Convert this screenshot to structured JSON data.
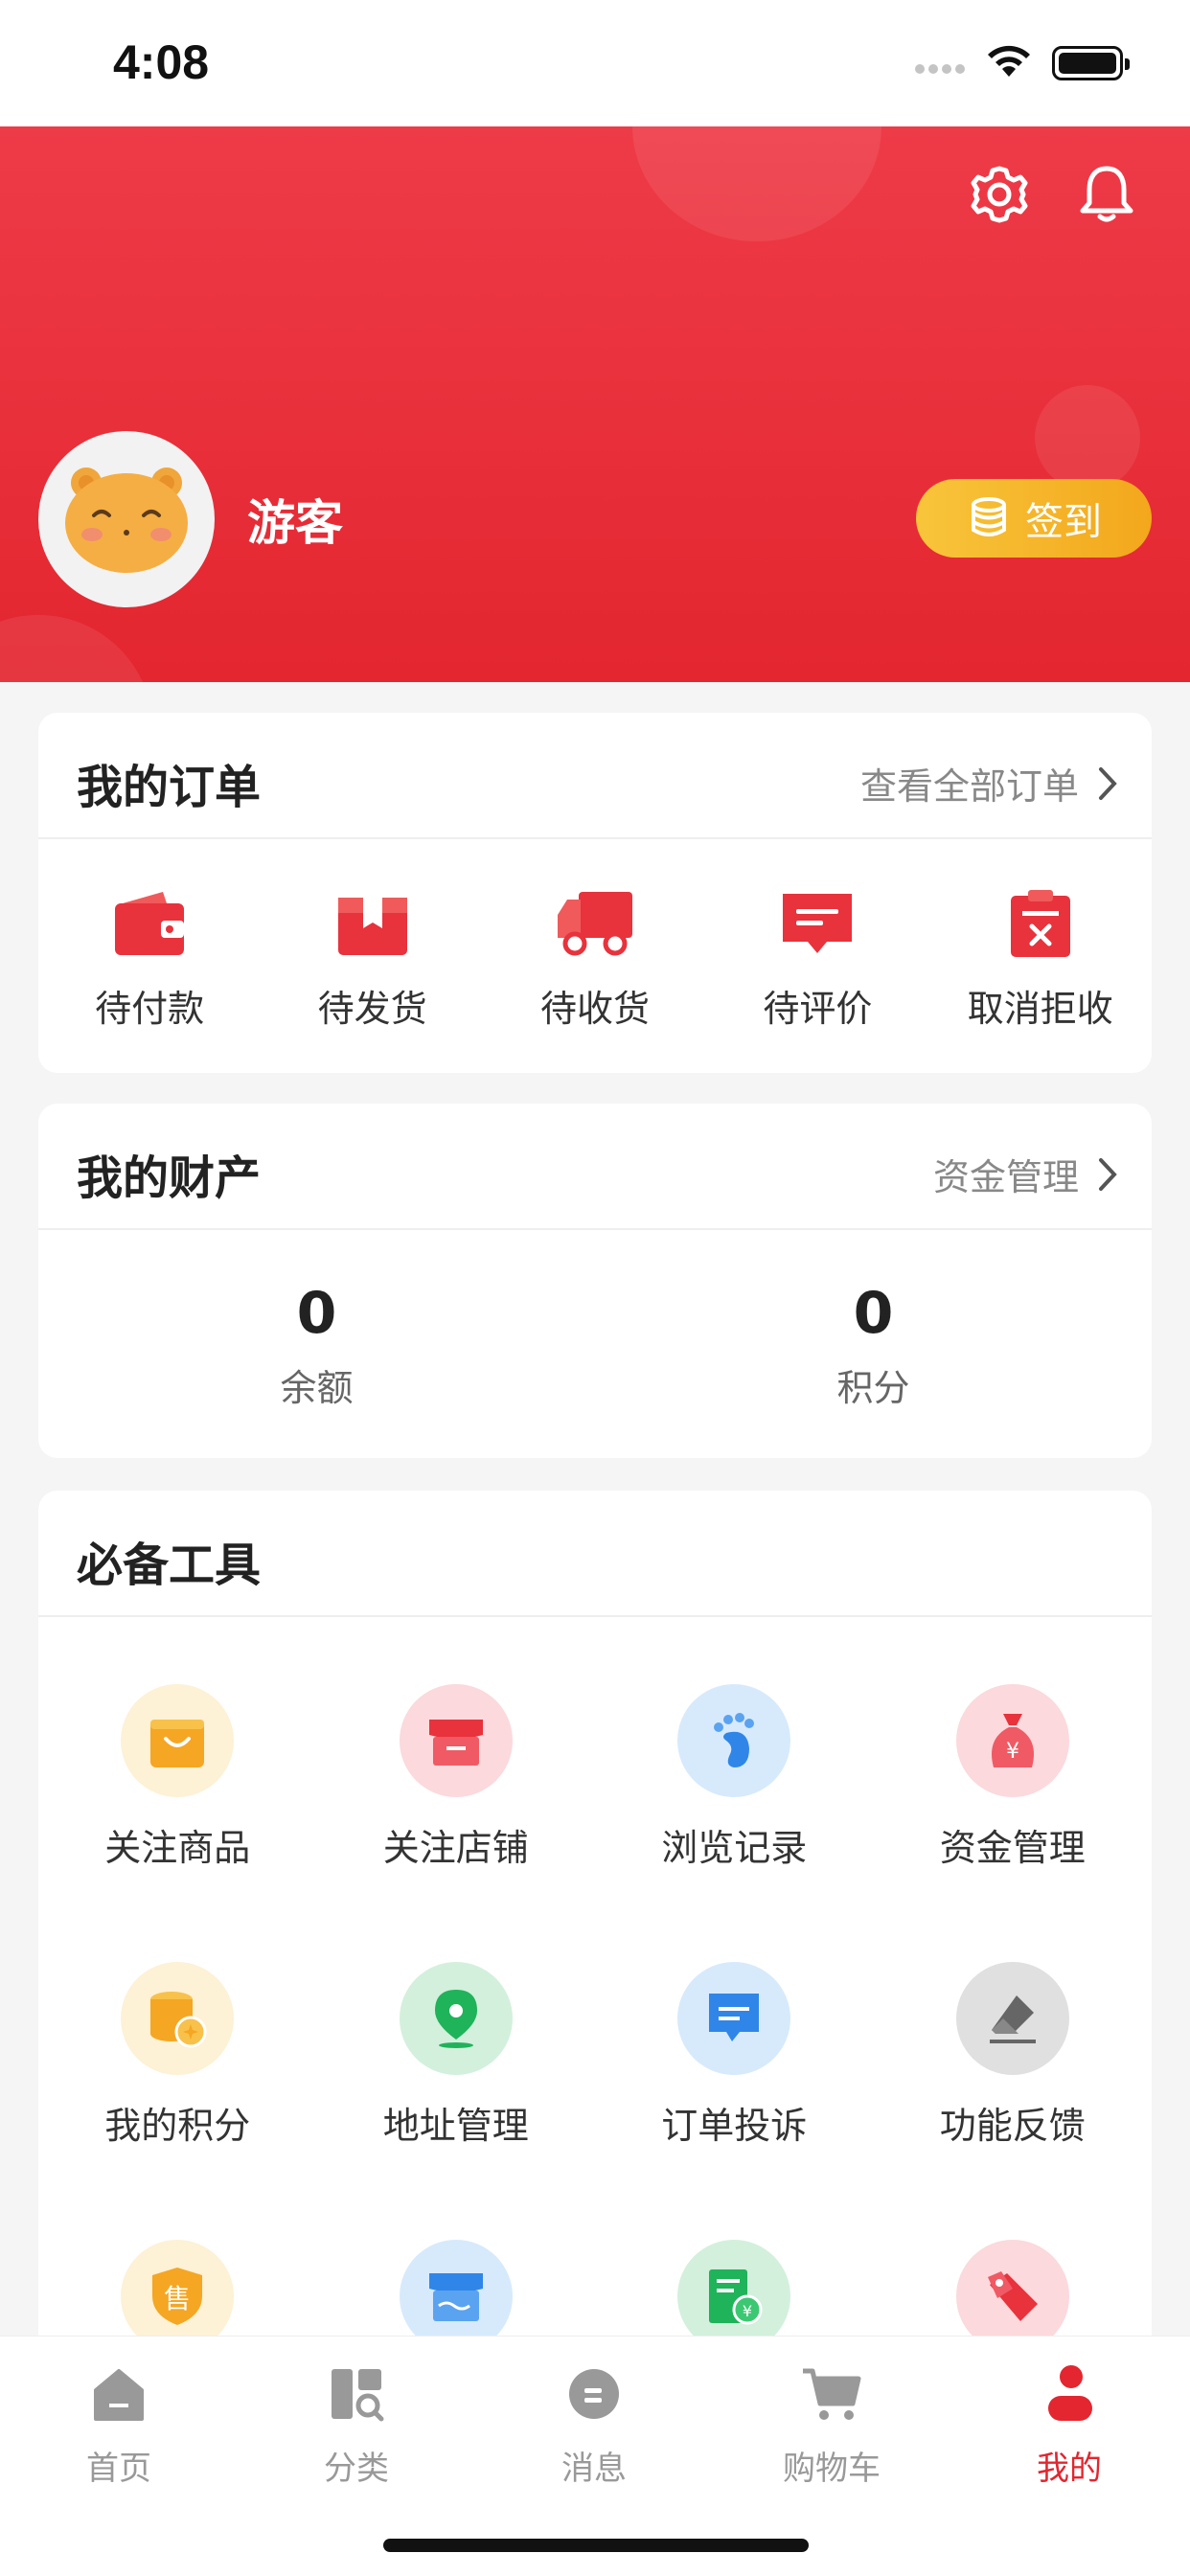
{
  "status_bar": {
    "time": "4:08"
  },
  "header": {
    "username": "游客",
    "signin_label": "签到",
    "colors": {
      "primary": "#e3262f",
      "signin": "#f5b52a"
    }
  },
  "orders": {
    "title": "我的订单",
    "view_all": "查看全部订单",
    "items": [
      {
        "label": "待付款",
        "icon": "wallet-icon"
      },
      {
        "label": "待发货",
        "icon": "package-icon"
      },
      {
        "label": "待收货",
        "icon": "truck-icon"
      },
      {
        "label": "待评价",
        "icon": "review-icon"
      },
      {
        "label": "取消拒收",
        "icon": "cancel-clipboard-icon"
      }
    ]
  },
  "assets": {
    "title": "我的财产",
    "link": "资金管理",
    "items": [
      {
        "value": "0",
        "label": "余额"
      },
      {
        "value": "0",
        "label": "积分"
      }
    ]
  },
  "tools": {
    "title": "必备工具",
    "items": [
      {
        "label": "关注商品",
        "icon": "shopping-bag-icon"
      },
      {
        "label": "关注店铺",
        "icon": "store-icon"
      },
      {
        "label": "浏览记录",
        "icon": "footprint-icon"
      },
      {
        "label": "资金管理",
        "icon": "money-bag-icon"
      },
      {
        "label": "我的积分",
        "icon": "coins-icon"
      },
      {
        "label": "地址管理",
        "icon": "location-pin-icon"
      },
      {
        "label": "订单投诉",
        "icon": "chat-bubble-icon"
      },
      {
        "label": "功能反馈",
        "icon": "eraser-icon"
      },
      {
        "label": "",
        "icon": "after-sale-shield-icon",
        "glyph": "售"
      },
      {
        "label": "",
        "icon": "shop-icon"
      },
      {
        "label": "",
        "icon": "receipt-icon"
      },
      {
        "label": "",
        "icon": "coupon-icon"
      }
    ]
  },
  "tabbar": {
    "items": [
      {
        "label": "首页",
        "icon": "home-icon"
      },
      {
        "label": "分类",
        "icon": "category-icon"
      },
      {
        "label": "消息",
        "icon": "message-icon"
      },
      {
        "label": "购物车",
        "icon": "cart-icon"
      },
      {
        "label": "我的",
        "icon": "profile-icon",
        "active": true
      }
    ]
  }
}
